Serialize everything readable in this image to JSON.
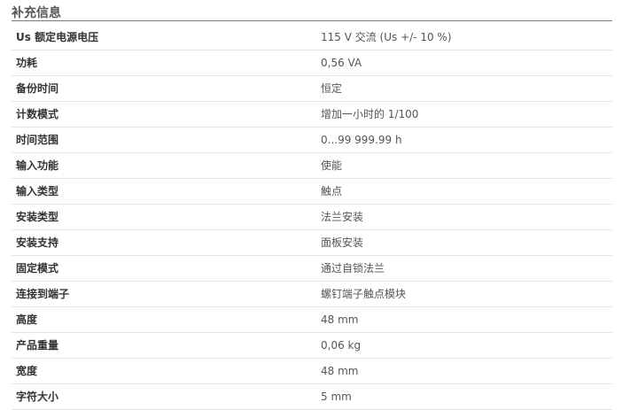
{
  "section": {
    "title": "补充信息"
  },
  "specs": [
    {
      "label": "Us 额定电源电压",
      "value": "115 V 交流 (Us +/- 10 %)"
    },
    {
      "label": "功耗",
      "value": "0,56 VA"
    },
    {
      "label": "备份时间",
      "value": "恒定"
    },
    {
      "label": "计数模式",
      "value": "增加一小时的 1/100"
    },
    {
      "label": "时间范围",
      "value": "0...99 999.99 h"
    },
    {
      "label": "输入功能",
      "value": "使能"
    },
    {
      "label": "输入类型",
      "value": "触点"
    },
    {
      "label": "安装类型",
      "value": "法兰安装"
    },
    {
      "label": "安装支持",
      "value": "面板安装"
    },
    {
      "label": "固定模式",
      "value": "通过自锁法兰"
    },
    {
      "label": "连接到端子",
      "value": "螺钉端子触点模块"
    },
    {
      "label": "高度",
      "value": "48 mm"
    },
    {
      "label": "产品重量",
      "value": "0,06 kg"
    },
    {
      "label": "宽度",
      "value": "48 mm"
    },
    {
      "label": "字符大小",
      "value": "5 mm"
    }
  ]
}
